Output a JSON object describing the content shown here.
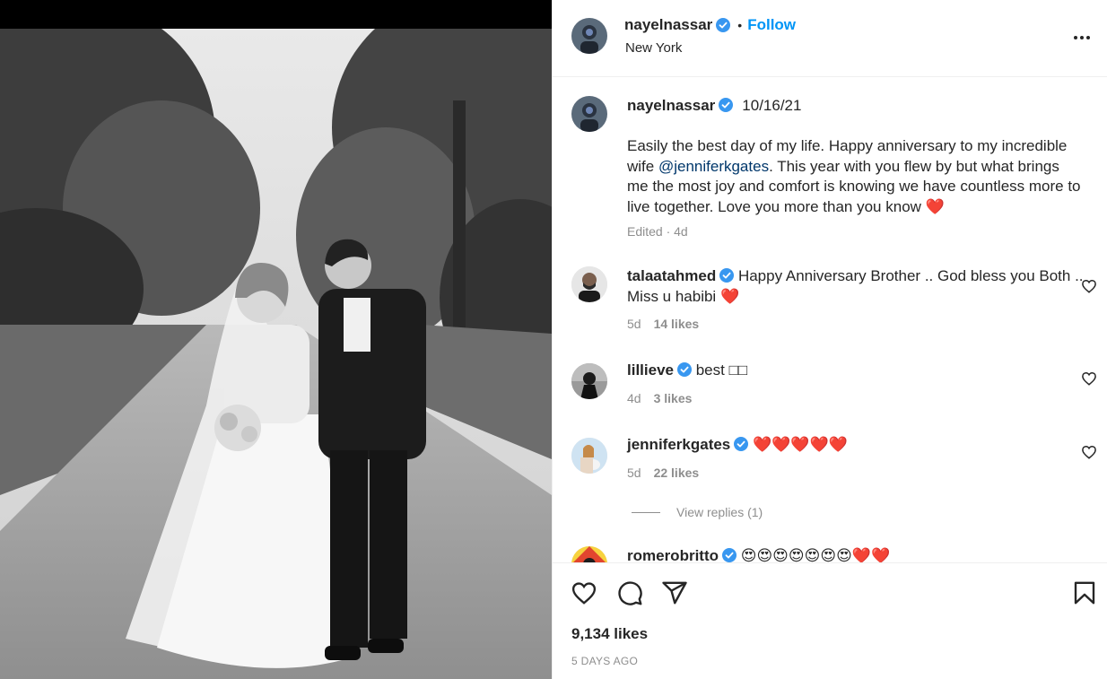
{
  "header": {
    "username": "nayelnassar",
    "separator": "•",
    "follow_label": "Follow",
    "location": "New York"
  },
  "caption": {
    "username": "nayelnassar",
    "date": "10/16/21",
    "text_before": "Easily the best day of my life. Happy anniversary to my incredible wife ",
    "mention": "@jenniferkgates",
    "text_after": ". This year with you flew by but what brings me the most joy and comfort is knowing we have countless more to live together. Love you more than you know ",
    "emoji": "❤️",
    "edited": "Edited · 4d"
  },
  "comments": [
    {
      "username": "talaatahmed",
      "text": "Happy Anniversary Brother .. God bless you Both .. Miss u habibi ",
      "emoji": "❤️",
      "age": "5d",
      "likes": "14 likes"
    },
    {
      "username": "lillieve",
      "text": "best ",
      "emoji": "□□",
      "age": "4d",
      "likes": "3 likes"
    },
    {
      "username": "jenniferkgates",
      "text": "",
      "emoji": "❤️❤️❤️❤️❤️",
      "age": "5d",
      "likes": "22 likes"
    },
    {
      "username": "romerobritto",
      "text": "",
      "emoji": "😍😍😍😍😍😍😍❤️❤️",
      "age": "",
      "likes": ""
    }
  ],
  "view_replies_label": "View replies (1)",
  "actions": {
    "likes_count": "9,134 likes",
    "time_ago": "5 DAYS AGO"
  },
  "colors": {
    "accent": "#0095f6",
    "verified": "#3897f0",
    "heart": "#e02130",
    "muted": "#8e8e8e"
  },
  "icons": [
    "verified-icon",
    "more-icon",
    "heart-icon",
    "comment-icon",
    "share-icon",
    "bookmark-icon"
  ]
}
